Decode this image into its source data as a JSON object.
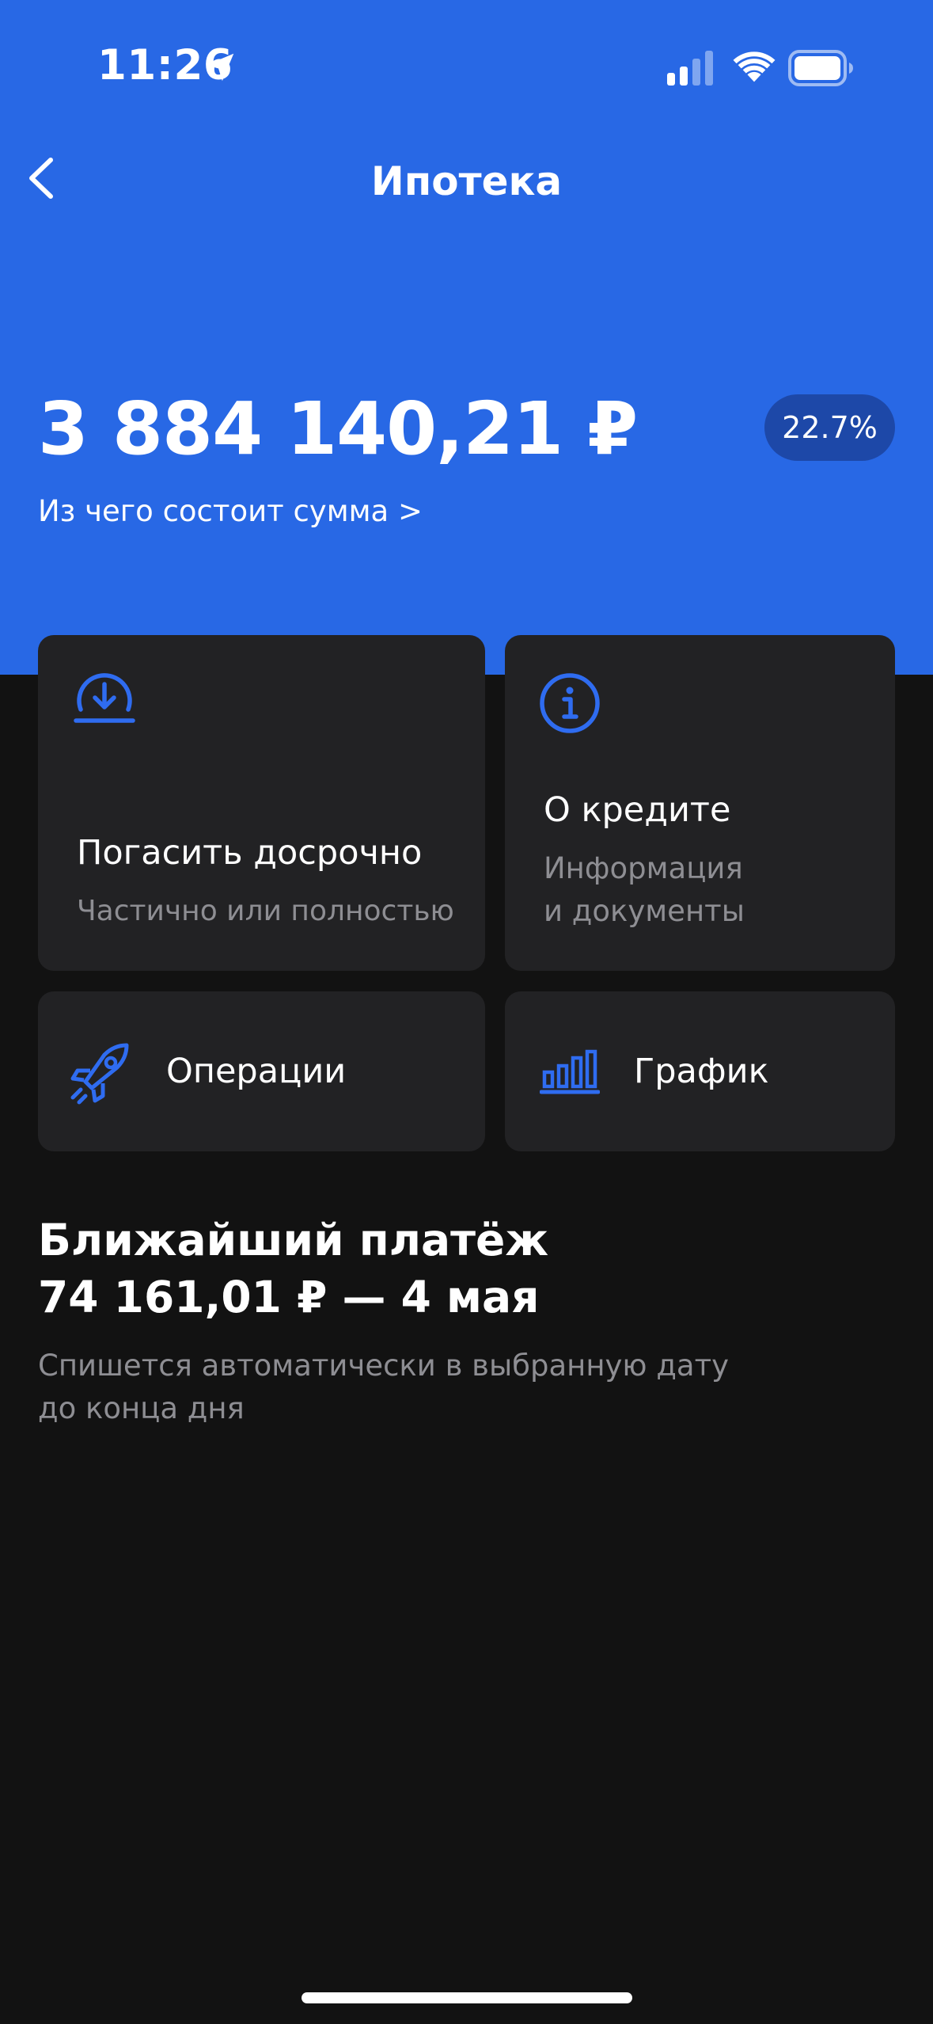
{
  "status_bar": {
    "time": "11:26",
    "icons": [
      "location-arrow-icon",
      "cellular-signal-icon",
      "wifi-icon",
      "battery-icon"
    ]
  },
  "nav": {
    "title": "Ипотека",
    "back_icon": "chevron-left-icon"
  },
  "summary": {
    "amount": "3 884 140,21 ₽",
    "percent": "22.7%",
    "breakdown_link": "Из чего состоит сумма >"
  },
  "actions": [
    {
      "title": "Погасить досрочно",
      "subtitle": "Частично или полностью",
      "icon": "download-circle-icon"
    },
    {
      "title": "О кредите",
      "subtitle_line1": "Информация",
      "subtitle_line2": "и документы",
      "icon": "info-circle-icon"
    },
    {
      "title": "Операции",
      "icon": "rocket-icon"
    },
    {
      "title": "График",
      "icon": "bar-chart-icon"
    }
  ],
  "next_payment": {
    "title": "Ближайший платёж",
    "amount_date": "74 161,01 ₽ — 4 мая",
    "desc_line1": "Спишется автоматически в выбранную дату",
    "desc_line2": "до конца дня"
  },
  "colors": {
    "brand_blue": "#2868E5",
    "badge_blue": "#1D48A8",
    "icon_blue": "#2F6CF0",
    "background": "#121212",
    "card": "#222224",
    "muted_text": "#8E8E93"
  }
}
